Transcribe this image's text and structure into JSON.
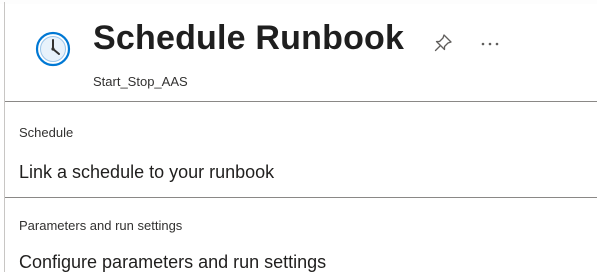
{
  "header": {
    "title": "Schedule Runbook",
    "subtitle": "Start_Stop_AAS",
    "icons": {
      "main": "clock-icon",
      "pin": "pin-icon",
      "more": "more-icon"
    }
  },
  "sections": [
    {
      "label": "Schedule",
      "text": "Link a schedule to your runbook"
    },
    {
      "label": "Parameters and run settings",
      "text": "Configure parameters and run settings"
    }
  ],
  "colors": {
    "accent": "#0078d4",
    "divider": "#8a8886",
    "text": "#201f1e"
  }
}
